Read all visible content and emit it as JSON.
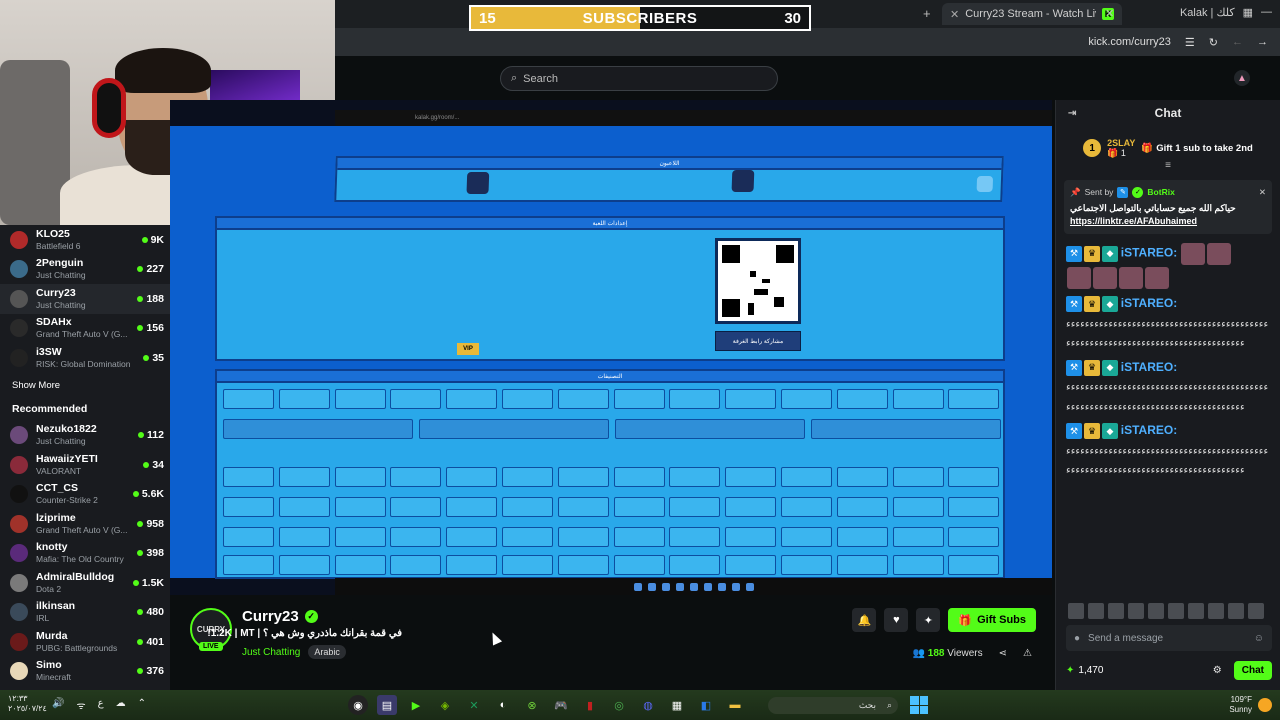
{
  "browser": {
    "tab_title": "Curry23 Stream - Watch Live on",
    "tab_right_label": "Kalak | كلك",
    "url": "kick.com/curry23"
  },
  "sub_goal": {
    "current": "15",
    "label": "SUBSCRIBERS",
    "target": "30",
    "progress": 0.5
  },
  "header": {
    "search_placeholder": "Search"
  },
  "sidebar": {
    "following": [
      {
        "name": "KLO25",
        "category": "Battlefield 6",
        "viewers": "9K",
        "color": "#b02a2a"
      },
      {
        "name": "2Penguin",
        "category": "Just Chatting",
        "viewers": "227",
        "color": "#3b6b8a"
      },
      {
        "name": "Curry23",
        "category": "Just Chatting",
        "viewers": "188",
        "color": "#555"
      },
      {
        "name": "SDAHx",
        "category": "Grand Theft Auto V (G...",
        "viewers": "156",
        "color": "#2a2a2a"
      },
      {
        "name": "i3SW",
        "category": "RISK: Global Domination",
        "viewers": "35",
        "color": "#222"
      }
    ],
    "show_more": "Show More",
    "recommended_label": "Recommended",
    "recommended": [
      {
        "name": "Nezuko1822",
        "category": "Just Chatting",
        "viewers": "112",
        "color": "#6b4a7a"
      },
      {
        "name": "HawaiizYETI",
        "category": "VALORANT",
        "viewers": "34",
        "color": "#8a2a3a"
      },
      {
        "name": "CCT_CS",
        "category": "Counter-Strike 2",
        "viewers": "5.6K",
        "color": "#111"
      },
      {
        "name": "lziprime",
        "category": "Grand Theft Auto V (G...",
        "viewers": "958",
        "color": "#a0322a"
      },
      {
        "name": "knotty",
        "category": "Mafia: The Old Country",
        "viewers": "398",
        "color": "#5a2a7a"
      },
      {
        "name": "AdmiralBulldog",
        "category": "Dota 2",
        "viewers": "1.5K",
        "color": "#7a7a7a"
      },
      {
        "name": "ilkinsan",
        "category": "IRL",
        "viewers": "480",
        "color": "#3a4a5a"
      },
      {
        "name": "Murda",
        "category": "PUBG: Battlegrounds",
        "viewers": "401",
        "color": "#6a1a1a"
      },
      {
        "name": "Simo",
        "category": "Minecraft",
        "viewers": "376",
        "color": "#e8d8b8"
      }
    ]
  },
  "stream": {
    "game_url": "kalak.gg/room/...",
    "panel_players": "اللاعبون",
    "panel_settings": "إعدادات اللعبة",
    "panel_categories": "التصنيفات",
    "share_button": "مشاركة رابط الغرفة",
    "vip": "VIP"
  },
  "channel": {
    "name": "Curry23",
    "avatar_text": "CURRY",
    "live": "LIVE",
    "title": "في قمة بقرانك ماذدري وش هي ؟ | 1.2K | MT!",
    "category": "Just Chatting",
    "tag": "Arabic",
    "gift_subs": "Gift Subs",
    "viewers": "188",
    "viewers_label": "Viewers"
  },
  "chat": {
    "title": "Chat",
    "top_gifter_name": "2SLAY",
    "top_gifter_count": "1",
    "top_rank": "1",
    "gift_prompt": "Gift 1 sub to take 2nd",
    "pinned_sent_by": "Sent by",
    "pinned_bot": "BotRix",
    "pinned_text": "حياكم الله جميع حساباتي بالتواصل الاجتماعي",
    "pinned_link": "https://linktr.ee/AFAbuhaimed",
    "messages": [
      {
        "user": "iSTAREO:",
        "text": ""
      },
      {
        "user": "iSTAREO:",
        "text": "ﺀﺀﺀﺀﺀﺀﺀﺀﺀﺀﺀﺀﺀﺀﺀﺀﺀﺀﺀﺀﺀﺀﺀﺀﺀﺀﺀﺀﺀﺀﺀﺀﺀﺀﺀﺀﺀﺀﺀﺀﺀﺀﺀﺀﺀﺀﺀﺀﺀﺀﺀﺀﺀﺀﺀﺀﺀﺀﺀﺀﺀﺀﺀﺀﺀﺀﺀﺀﺀﺀﺀﺀﺀﺀﺀﺀﺀﺀﺀﺀﺀ"
      },
      {
        "user": "iSTAREO:",
        "text": "ﺀﺀﺀﺀﺀﺀﺀﺀﺀﺀﺀﺀﺀﺀﺀﺀﺀﺀﺀﺀﺀﺀﺀﺀﺀﺀﺀﺀﺀﺀﺀﺀﺀﺀﺀﺀﺀﺀﺀﺀﺀﺀﺀﺀﺀﺀﺀﺀﺀﺀﺀﺀﺀﺀﺀﺀﺀﺀﺀﺀﺀﺀﺀﺀﺀﺀﺀﺀﺀﺀﺀﺀﺀﺀﺀﺀﺀﺀﺀﺀﺀ"
      },
      {
        "user": "iSTAREO:",
        "text": "ﺀﺀﺀﺀﺀﺀﺀﺀﺀﺀﺀﺀﺀﺀﺀﺀﺀﺀﺀﺀﺀﺀﺀﺀﺀﺀﺀﺀﺀﺀﺀﺀﺀﺀﺀﺀﺀﺀﺀﺀﺀﺀﺀﺀﺀﺀﺀﺀﺀﺀﺀﺀﺀﺀﺀﺀﺀﺀﺀﺀﺀﺀﺀﺀﺀﺀﺀﺀﺀﺀﺀﺀﺀﺀﺀﺀﺀﺀﺀﺀﺀ"
      }
    ],
    "input_placeholder": "Send a message",
    "points": "1,470",
    "chat_button": "Chat"
  },
  "taskbar": {
    "time": "١٢:٣٣",
    "date": "٢٠٢٥/٠٧/٢٤",
    "search": "بحث",
    "temp": "109°F",
    "weather": "Sunny"
  }
}
